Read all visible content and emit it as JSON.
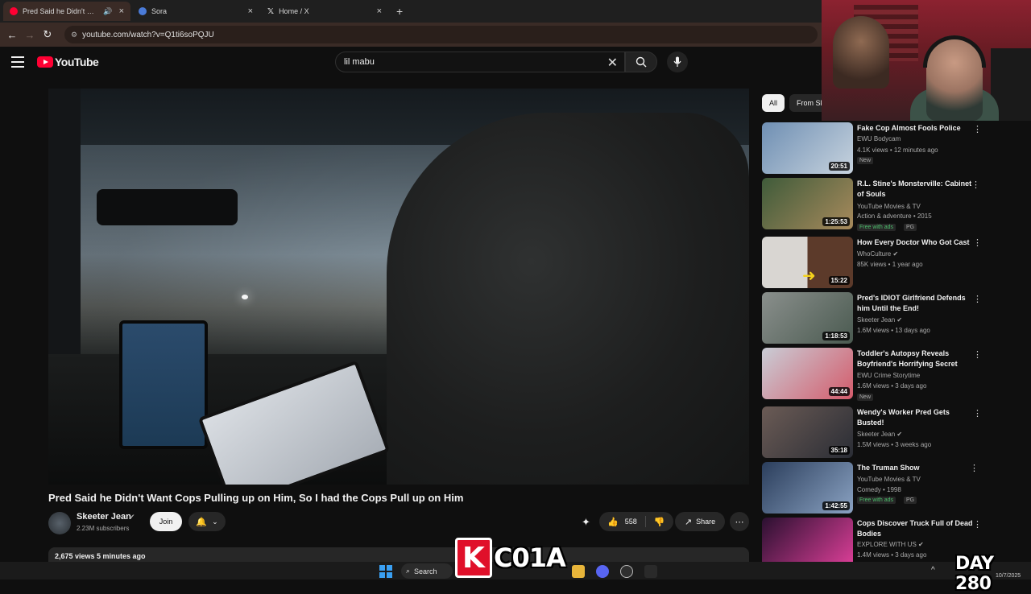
{
  "browser": {
    "tabs": [
      {
        "title": "Pred Said he Didn't Want C",
        "audio_icon": "speaker-icon",
        "favicon_color": "#ff0033",
        "active": true
      },
      {
        "title": "Sora",
        "favicon_color": "#4a7bd8",
        "active": false
      },
      {
        "title": "Home / X",
        "favicon_color": "#ffffff",
        "active": false
      }
    ],
    "url": "youtube.com/watch?v=Q1ti6soPQJU"
  },
  "youtube": {
    "logo_text": "YouTube",
    "search_value": "lil mabu"
  },
  "video": {
    "title": "Pred Said he Didn't Want Cops Pulling up on Him, So I had the Cops Pull up on Him",
    "channel": "Skeeter Jean",
    "subscribers": "2.23M subscribers",
    "join_label": "Join",
    "likes": "558",
    "share_label": "Share",
    "stats": "2,675 views  5 minutes ago"
  },
  "sidebar": {
    "chips": [
      {
        "label": "All",
        "selected": true
      },
      {
        "label": "From Sk",
        "selected": false
      }
    ],
    "recommendations": [
      {
        "title": "Fake Cop Almost Fools Police",
        "channel": "EWU Bodycam",
        "meta": "4.1K views • 12 minutes ago",
        "badge": "New",
        "duration": "20:51",
        "thumb_colors": [
          "#6f8fb3",
          "#c7d3de"
        ]
      },
      {
        "title": "R.L. Stine's Monsterville: Cabinet of Souls",
        "channel": "YouTube Movies & TV",
        "meta": "Action & adventure • 2015",
        "free": "Free with ads",
        "rating": "PG",
        "duration": "1:25:53",
        "thumb_colors": [
          "#3f5b3a",
          "#a88a5c"
        ]
      },
      {
        "title": "How Every Doctor Who Got Cast",
        "channel": "WhoCulture",
        "verified": true,
        "meta": "85K views • 1 year ago",
        "duration": "15:22",
        "thumb_colors": [
          "#d9d6d2",
          "#5c3a2a"
        ]
      },
      {
        "title": "Pred's IDIOT Girlfriend Defends him Until the End!",
        "channel": "Skeeter Jean",
        "verified": true,
        "meta": "1.6M views • 13 days ago",
        "duration": "1:18:53",
        "thumb_colors": [
          "#8a8f8c",
          "#4a5a50"
        ]
      },
      {
        "title": "Toddler's Autopsy Reveals Boyfriend's Horrifying Secret",
        "channel": "EWU Crime Storytime",
        "meta": "1.6M views • 3 days ago",
        "badge": "New",
        "duration": "44:44",
        "thumb_colors": [
          "#c9cdd6",
          "#d45b6b"
        ]
      },
      {
        "title": "Wendy's Worker Pred Gets Busted!",
        "channel": "Skeeter Jean",
        "verified": true,
        "meta": "1.5M views • 3 weeks ago",
        "duration": "35:18",
        "thumb_colors": [
          "#6b5b55",
          "#2a2d35"
        ]
      },
      {
        "title": "The Truman Show",
        "channel": "YouTube Movies & TV",
        "meta": "Comedy • 1998",
        "free": "Free with ads",
        "rating": "PG",
        "duration": "1:42:55",
        "thumb_colors": [
          "#2b3e5c",
          "#8aa2c2"
        ]
      },
      {
        "title": "Cops Discover Truck Full of Dead Bodies",
        "channel": "EXPLORE WITH US",
        "verified": true,
        "meta": "1.4M views • 3 days ago",
        "duration": "",
        "thumb_colors": [
          "#2a1030",
          "#e0409a"
        ]
      }
    ]
  },
  "taskbar": {
    "search_label": "Search",
    "overlay_brand_k": "K",
    "overlay_brand_text": "C01A",
    "day_counter": "DAY  280",
    "date": "10/7/2025"
  },
  "colors": {
    "yt_red": "#ff0033",
    "page_bg": "#0f0f0f",
    "free_green": "#4bbf6b"
  }
}
